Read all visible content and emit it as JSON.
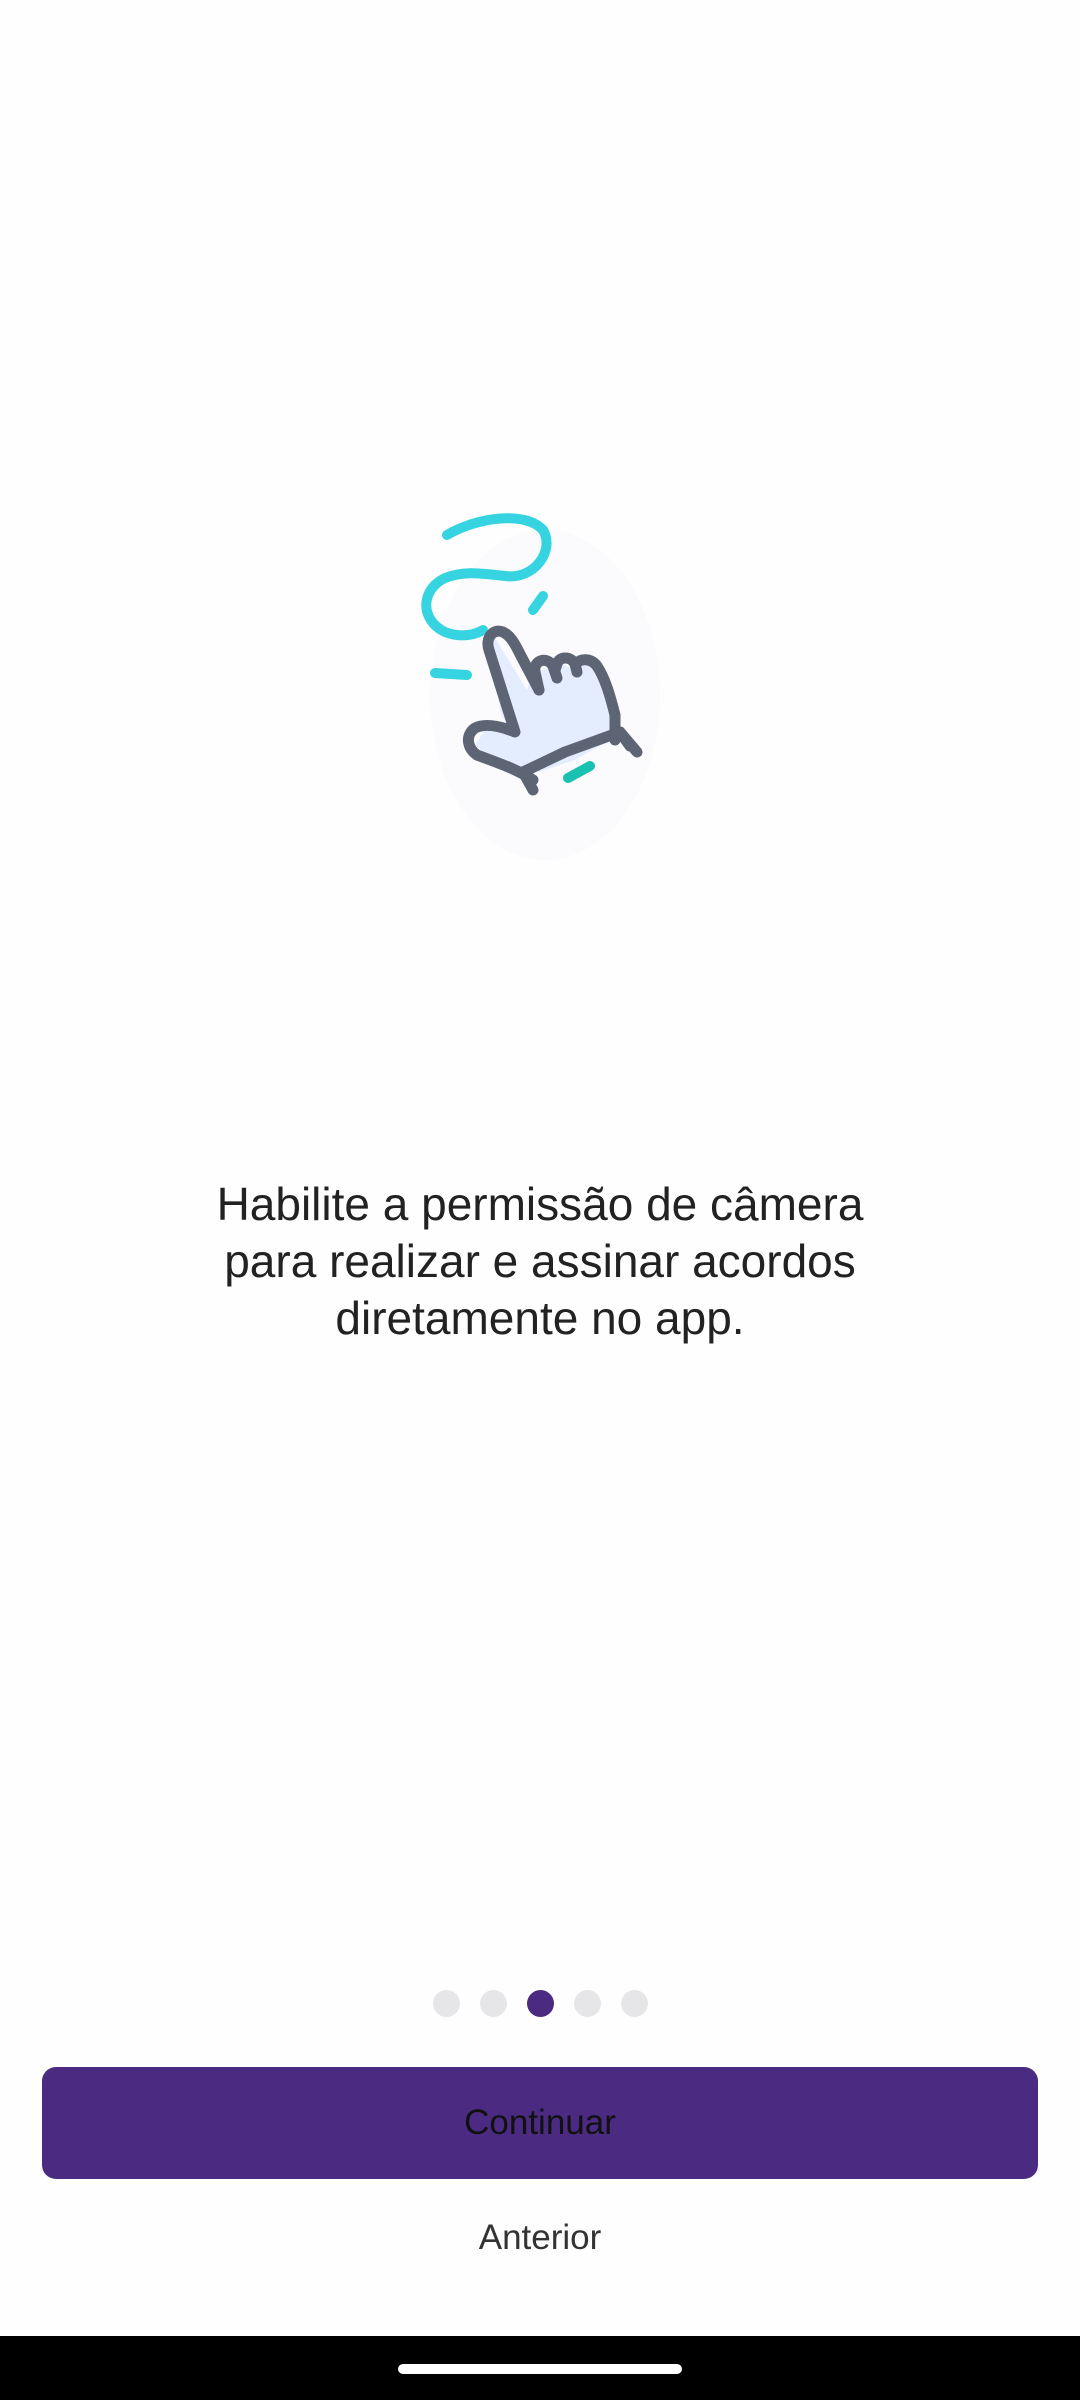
{
  "onboarding": {
    "illustration": "hand-signing-icon",
    "message_line1": "Habilite a permissão de câmera",
    "message_line2": "para realizar e assinar acordos",
    "message_line3": "diretamente no app.",
    "pager": {
      "total": 5,
      "current": 3
    }
  },
  "actions": {
    "continue_label": "Continuar",
    "previous_label": "Anterior"
  },
  "colors": {
    "accent": "#4b2a82",
    "illustration_cyan": "#35d4e0",
    "illustration_teal": "#19c2b0",
    "illustration_outline": "#5d6473",
    "illustration_fill": "#e4edfd",
    "dot_inactive": "#e6e6e8"
  }
}
